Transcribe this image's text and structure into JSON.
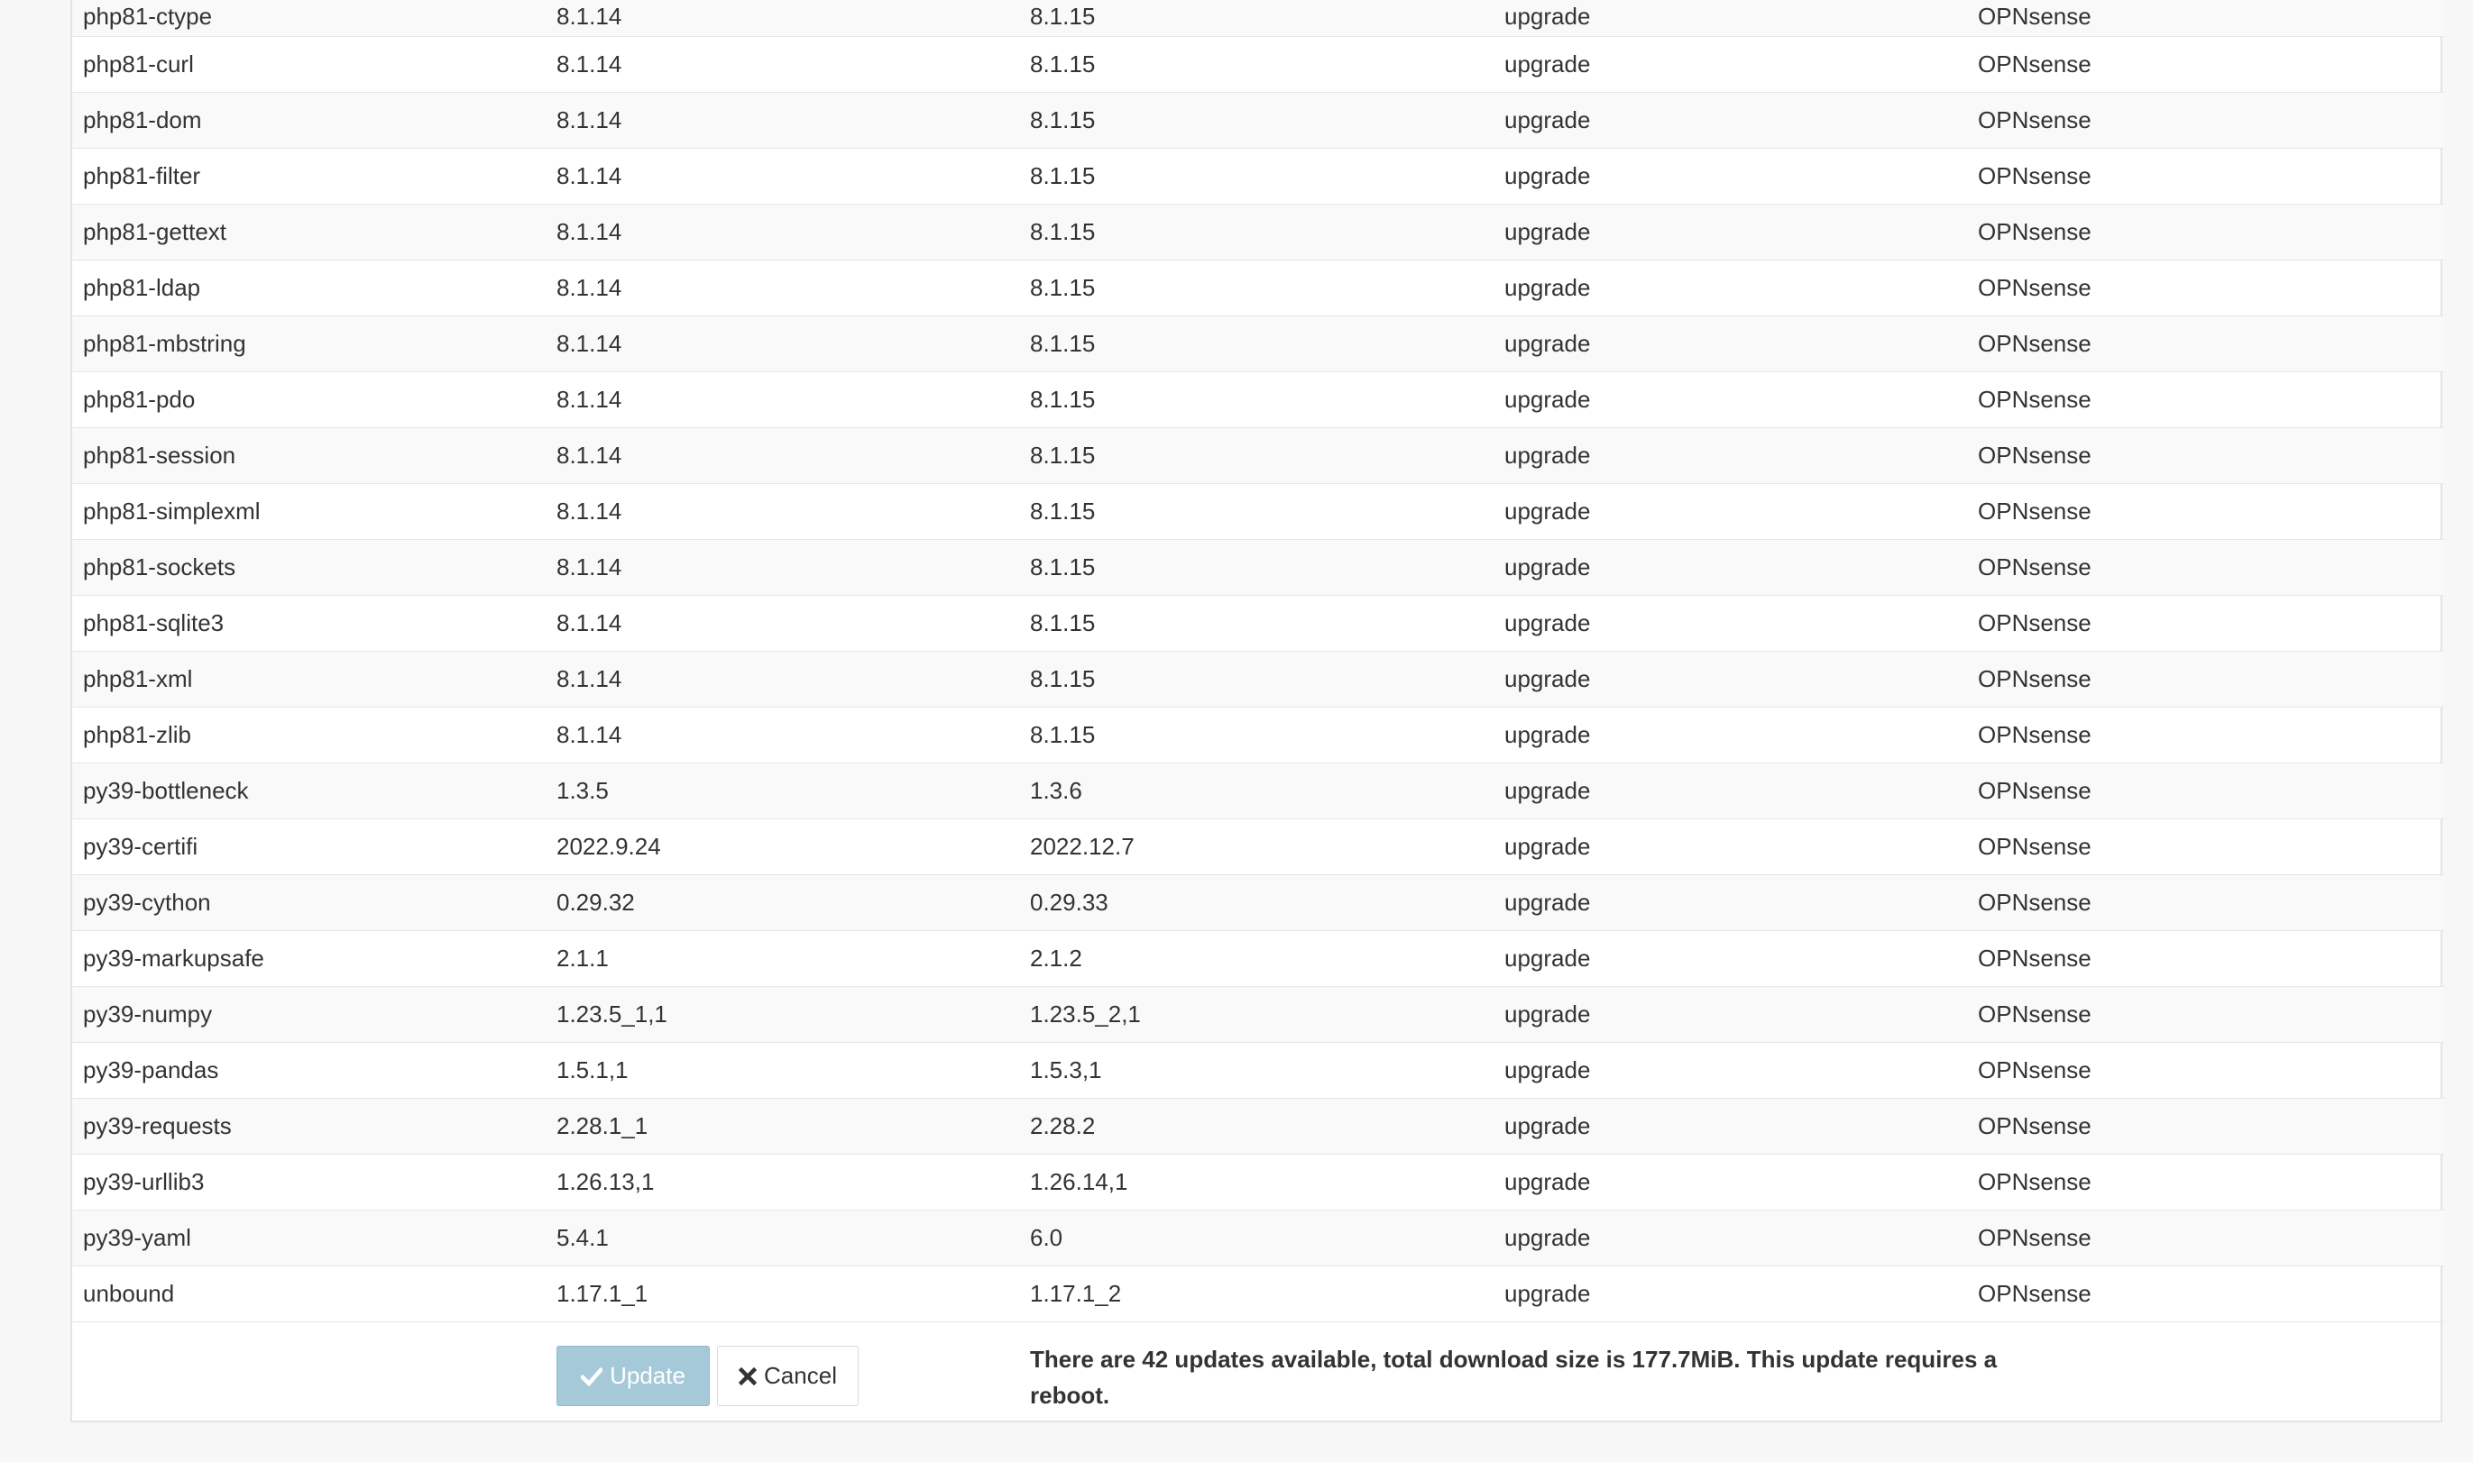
{
  "packages": [
    {
      "name": "php81-ctype",
      "current": "8.1.14",
      "new": "8.1.15",
      "action": "upgrade",
      "repository": "OPNsense"
    },
    {
      "name": "php81-curl",
      "current": "8.1.14",
      "new": "8.1.15",
      "action": "upgrade",
      "repository": "OPNsense"
    },
    {
      "name": "php81-dom",
      "current": "8.1.14",
      "new": "8.1.15",
      "action": "upgrade",
      "repository": "OPNsense"
    },
    {
      "name": "php81-filter",
      "current": "8.1.14",
      "new": "8.1.15",
      "action": "upgrade",
      "repository": "OPNsense"
    },
    {
      "name": "php81-gettext",
      "current": "8.1.14",
      "new": "8.1.15",
      "action": "upgrade",
      "repository": "OPNsense"
    },
    {
      "name": "php81-ldap",
      "current": "8.1.14",
      "new": "8.1.15",
      "action": "upgrade",
      "repository": "OPNsense"
    },
    {
      "name": "php81-mbstring",
      "current": "8.1.14",
      "new": "8.1.15",
      "action": "upgrade",
      "repository": "OPNsense"
    },
    {
      "name": "php81-pdo",
      "current": "8.1.14",
      "new": "8.1.15",
      "action": "upgrade",
      "repository": "OPNsense"
    },
    {
      "name": "php81-session",
      "current": "8.1.14",
      "new": "8.1.15",
      "action": "upgrade",
      "repository": "OPNsense"
    },
    {
      "name": "php81-simplexml",
      "current": "8.1.14",
      "new": "8.1.15",
      "action": "upgrade",
      "repository": "OPNsense"
    },
    {
      "name": "php81-sockets",
      "current": "8.1.14",
      "new": "8.1.15",
      "action": "upgrade",
      "repository": "OPNsense"
    },
    {
      "name": "php81-sqlite3",
      "current": "8.1.14",
      "new": "8.1.15",
      "action": "upgrade",
      "repository": "OPNsense"
    },
    {
      "name": "php81-xml",
      "current": "8.1.14",
      "new": "8.1.15",
      "action": "upgrade",
      "repository": "OPNsense"
    },
    {
      "name": "php81-zlib",
      "current": "8.1.14",
      "new": "8.1.15",
      "action": "upgrade",
      "repository": "OPNsense"
    },
    {
      "name": "py39-bottleneck",
      "current": "1.3.5",
      "new": "1.3.6",
      "action": "upgrade",
      "repository": "OPNsense"
    },
    {
      "name": "py39-certifi",
      "current": "2022.9.24",
      "new": "2022.12.7",
      "action": "upgrade",
      "repository": "OPNsense"
    },
    {
      "name": "py39-cython",
      "current": "0.29.32",
      "new": "0.29.33",
      "action": "upgrade",
      "repository": "OPNsense"
    },
    {
      "name": "py39-markupsafe",
      "current": "2.1.1",
      "new": "2.1.2",
      "action": "upgrade",
      "repository": "OPNsense"
    },
    {
      "name": "py39-numpy",
      "current": "1.23.5_1,1",
      "new": "1.23.5_2,1",
      "action": "upgrade",
      "repository": "OPNsense"
    },
    {
      "name": "py39-pandas",
      "current": "1.5.1,1",
      "new": "1.5.3,1",
      "action": "upgrade",
      "repository": "OPNsense"
    },
    {
      "name": "py39-requests",
      "current": "2.28.1_1",
      "new": "2.28.2",
      "action": "upgrade",
      "repository": "OPNsense"
    },
    {
      "name": "py39-urllib3",
      "current": "1.26.13,1",
      "new": "1.26.14,1",
      "action": "upgrade",
      "repository": "OPNsense"
    },
    {
      "name": "py39-yaml",
      "current": "5.4.1",
      "new": "6.0",
      "action": "upgrade",
      "repository": "OPNsense"
    },
    {
      "name": "unbound",
      "current": "1.17.1_1",
      "new": "1.17.1_2",
      "action": "upgrade",
      "repository": "OPNsense"
    }
  ],
  "footer": {
    "update_label": "Update",
    "update_icon": "check-icon",
    "cancel_label": "Cancel",
    "cancel_icon": "close-icon",
    "message": "There are 42 updates available, total download size is 177.7MiB. This update requires a reboot."
  },
  "colors": {
    "update_button_bg": "#a6c9d9",
    "page_bg": "#f7f7f7",
    "row_stripe": "#f9f9f9"
  }
}
